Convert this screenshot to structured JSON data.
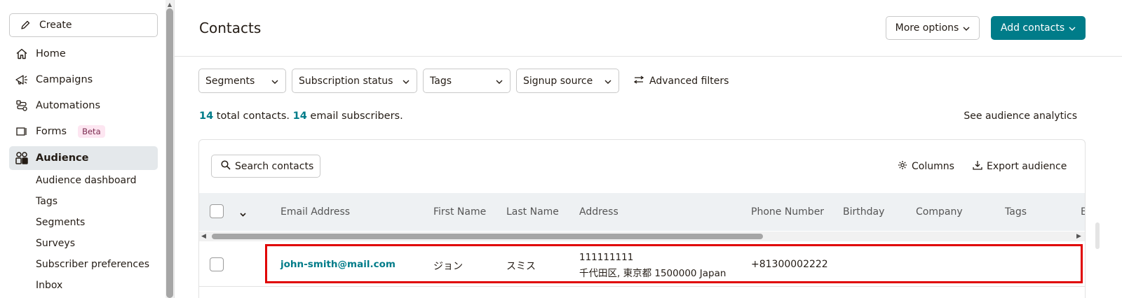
{
  "sidebar": {
    "create_label": "Create",
    "items": [
      {
        "label": "Home",
        "icon": "home-icon"
      },
      {
        "label": "Campaigns",
        "icon": "megaphone-icon"
      },
      {
        "label": "Automations",
        "icon": "automation-icon"
      },
      {
        "label": "Forms",
        "icon": "form-icon",
        "badge": "Beta"
      },
      {
        "label": "Audience",
        "icon": "audience-icon",
        "active": true
      }
    ],
    "sub_items": [
      "Audience dashboard",
      "Tags",
      "Segments",
      "Surveys",
      "Subscriber preferences",
      "Inbox"
    ]
  },
  "header": {
    "title": "Contacts",
    "more_options": "More options",
    "add_contacts": "Add contacts"
  },
  "filters": {
    "segments": "Segments",
    "subscription_status": "Subscription status",
    "tags": "Tags",
    "signup_source": "Signup source",
    "advanced": "Advanced filters"
  },
  "summary": {
    "total_count": "14",
    "total_text": "total contacts.",
    "email_count": "14",
    "email_text": "email subscribers.",
    "analytics_link": "See audience analytics"
  },
  "table": {
    "search_placeholder": "Search contacts",
    "columns_label": "Columns",
    "export_label": "Export audience",
    "headers": [
      "Email Address",
      "First Name",
      "Last Name",
      "Address",
      "Phone Number",
      "Birthday",
      "Company",
      "Tags",
      "E"
    ],
    "rows": [
      {
        "email": "john-smith@mail.com",
        "first_name": "ジョン",
        "last_name": "スミス",
        "address_line1": "111111111",
        "address_line2": "千代田区, 東京都 1500000 Japan",
        "phone": "+81300002222",
        "birthday": "",
        "company": "",
        "tags": ""
      }
    ]
  },
  "colors": {
    "accent": "#007c89",
    "highlight": "#e00000",
    "badge_bg": "#fde6f1"
  }
}
